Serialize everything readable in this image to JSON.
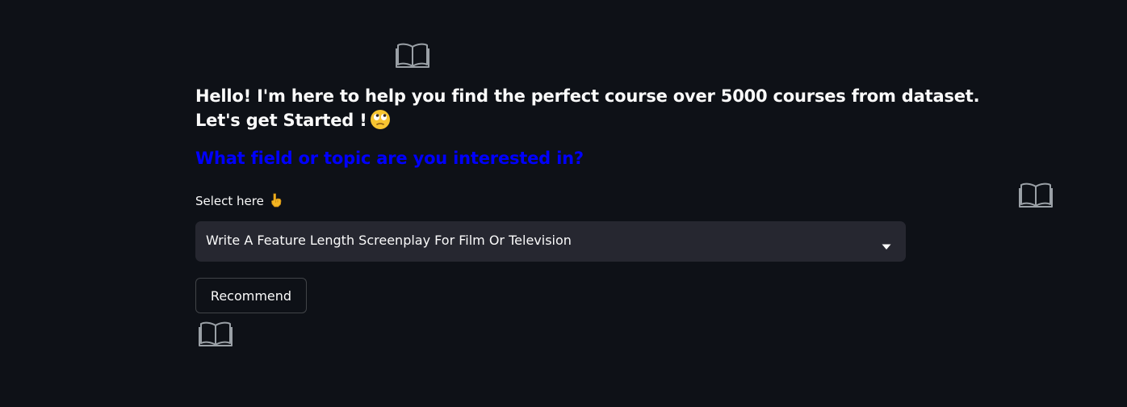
{
  "greeting": {
    "line1": "Hello! I'm here to help you find the perfect course over 5000 courses from dataset.",
    "line2": "Let's get Started !"
  },
  "question": "What field or topic are you interested in?",
  "select_label": "Select here",
  "select": {
    "value": "Write A Feature Length Screenplay For Film Or Television"
  },
  "recommend_button": "Recommend",
  "icons": {
    "decor": "open-book-icon",
    "greeting_emoji": "eyes-rolling-face-icon",
    "label_emoji": "pointing-down-hand-icon",
    "select_toggle": "chevron-down-icon"
  },
  "colors": {
    "background": "#0e1117",
    "text": "#fafafa",
    "question": "#0000ff",
    "select_bg": "#262730"
  }
}
